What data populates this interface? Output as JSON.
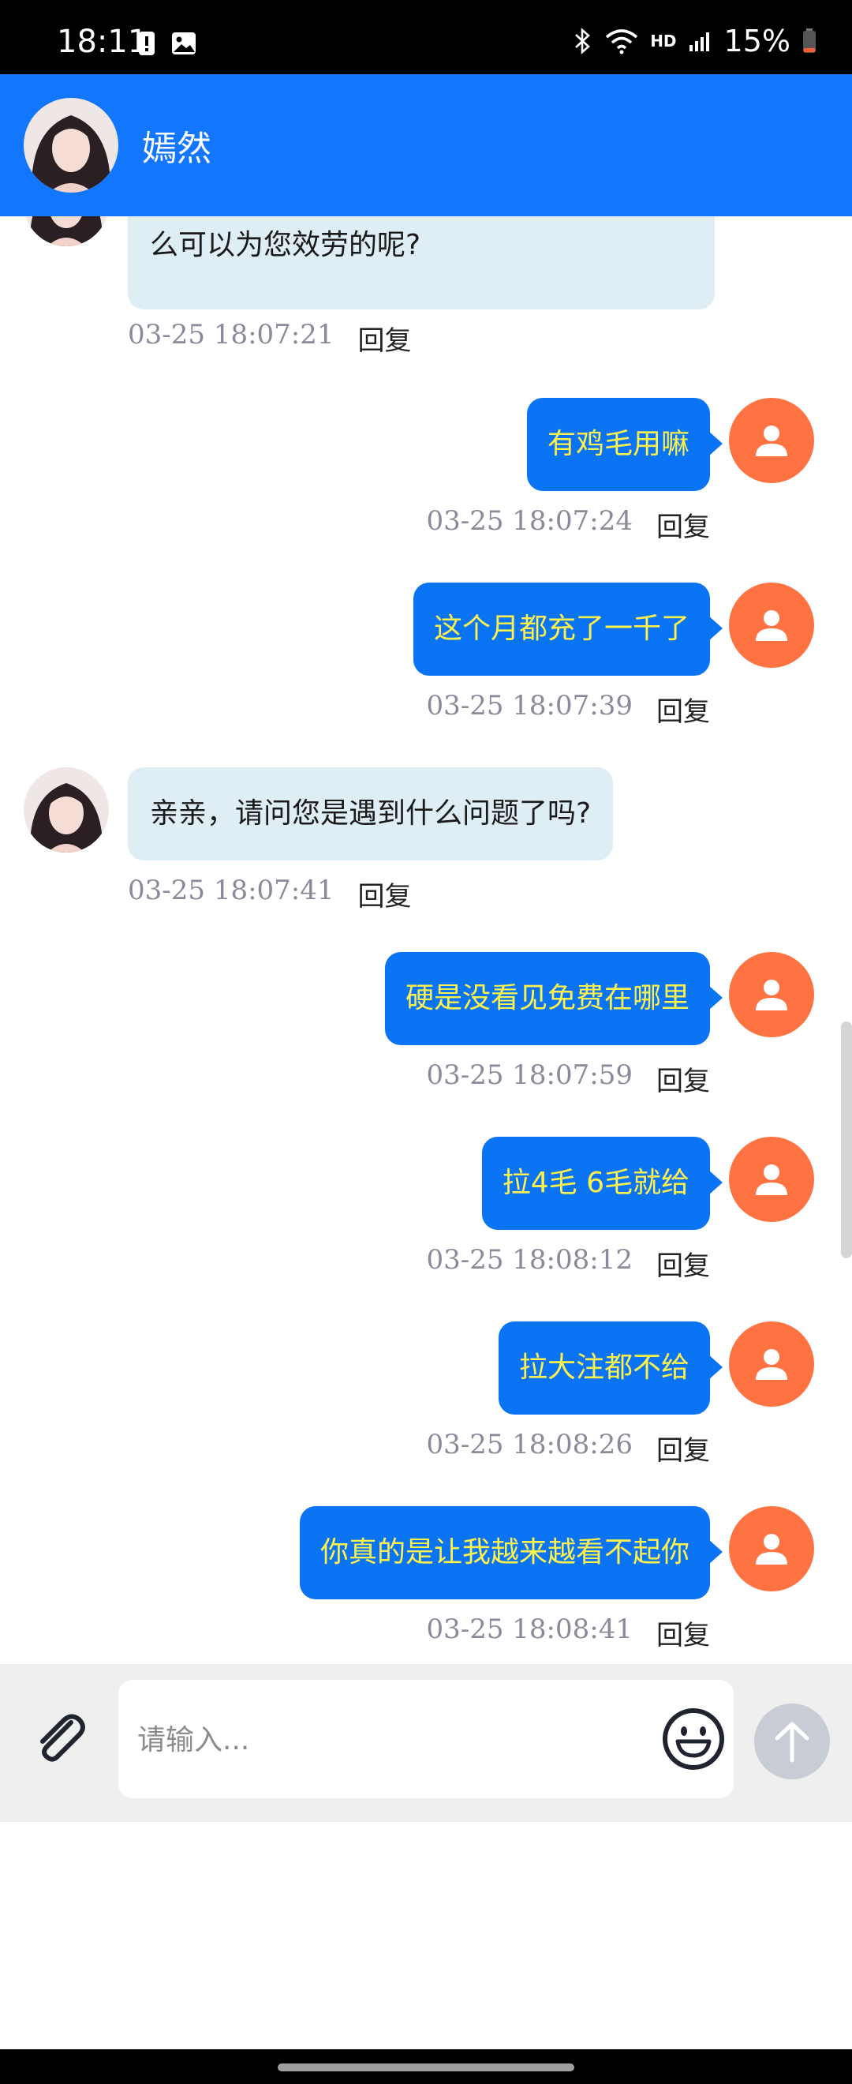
{
  "status_bar": {
    "time": "18:11",
    "hd": "HD",
    "battery": "15%"
  },
  "header": {
    "title": "嫣然"
  },
  "messages": [
    {
      "side": "in",
      "text": "么可以为您效劳的呢?",
      "time": "03-25 18:07:21",
      "reply": "回复"
    },
    {
      "side": "out",
      "text": "有鸡毛用嘛",
      "time": "03-25 18:07:24",
      "reply": "回复"
    },
    {
      "side": "out",
      "text": "这个月都充了一千了",
      "time": "03-25 18:07:39",
      "reply": "回复"
    },
    {
      "side": "in",
      "text": "亲亲，请问您是遇到什么问题了吗?",
      "time": "03-25 18:07:41",
      "reply": "回复"
    },
    {
      "side": "out",
      "text": "硬是没看见免费在哪里",
      "time": "03-25 18:07:59",
      "reply": "回复"
    },
    {
      "side": "out",
      "text": "拉4毛 6毛就给",
      "time": "03-25 18:08:12",
      "reply": "回复"
    },
    {
      "side": "out",
      "text": "拉大注都不给",
      "time": "03-25 18:08:26",
      "reply": "回复"
    },
    {
      "side": "out",
      "text": "你真的是让我越来越看不起你",
      "time": "03-25 18:08:41",
      "reply": "回复"
    }
  ],
  "input": {
    "placeholder": "请输入..."
  },
  "colors": {
    "header_bg": "#1276ff",
    "bubble_out_bg": "#0a74f5",
    "bubble_out_text": "#fff34b",
    "bubble_in_bg": "#dfeef5",
    "user_avatar_bg": "#ff7342"
  },
  "icons": {
    "attach": "paperclip-icon",
    "emoji": "smiley-icon",
    "send": "arrow-up-icon",
    "user": "person-icon"
  }
}
